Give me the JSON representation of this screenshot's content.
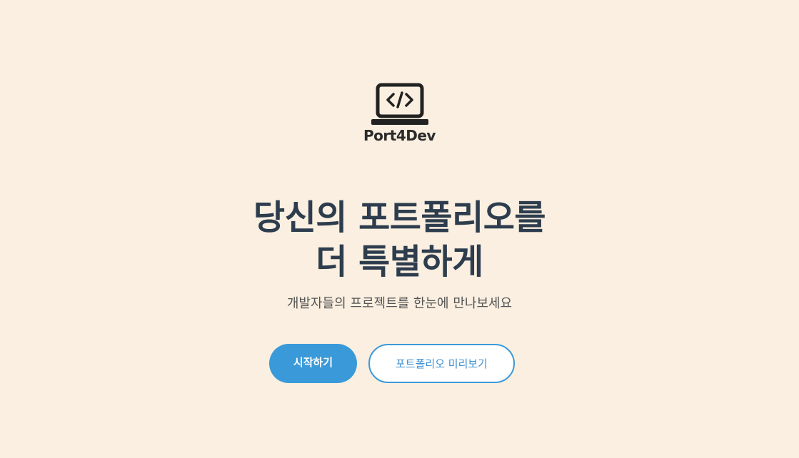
{
  "logo": {
    "icon": "laptop-code-icon",
    "text": "Port4Dev"
  },
  "hero": {
    "title_line1": "당신의 포트폴리오를",
    "title_line2": "더 특별하게",
    "subtitle": "개발자들의 프로젝트를 한눈에 만나보세요"
  },
  "buttons": {
    "start_label": "시작하기",
    "preview_label": "포트폴리오 미리보기"
  },
  "colors": {
    "background": "#faefe0",
    "title": "#2e3d4e",
    "accent": "#3a9ad9"
  }
}
